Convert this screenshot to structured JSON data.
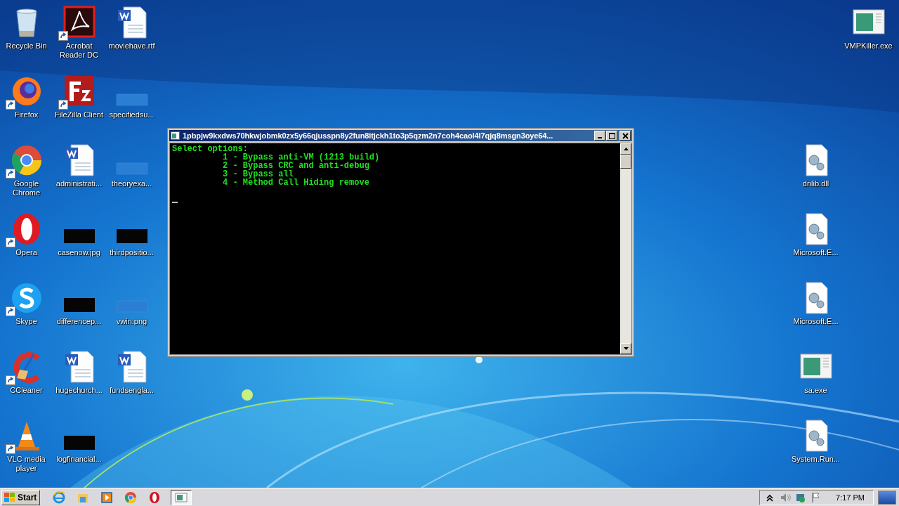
{
  "desktop": {
    "left_columns": [
      [
        {
          "kind": "recycle",
          "label": "Recycle Bin",
          "shortcut": false
        },
        {
          "kind": "firefox",
          "label": "Firefox",
          "shortcut": true
        },
        {
          "kind": "chrome",
          "label": "Google Chrome",
          "shortcut": true
        },
        {
          "kind": "opera",
          "label": "Opera",
          "shortcut": true
        },
        {
          "kind": "skype",
          "label": "Skype",
          "shortcut": true
        },
        {
          "kind": "ccleaner",
          "label": "CCleaner",
          "shortcut": true
        },
        {
          "kind": "vlc",
          "label": "VLC media player",
          "shortcut": true
        }
      ],
      [
        {
          "kind": "acrobat",
          "label": "Acrobat Reader DC",
          "shortcut": true
        },
        {
          "kind": "filezilla",
          "label": "FileZilla Client",
          "shortcut": true
        },
        {
          "kind": "word",
          "label": "administrati...",
          "shortcut": false
        },
        {
          "kind": "dark-thumb",
          "label": "casenow.jpg",
          "shortcut": false
        },
        {
          "kind": "dark-thumb",
          "label": "differencep...",
          "shortcut": false
        },
        {
          "kind": "word",
          "label": "hugechurch...",
          "shortcut": false
        },
        {
          "kind": "dark-thumb",
          "label": "logfinancial...",
          "shortcut": false
        }
      ],
      [
        {
          "kind": "word",
          "label": "moviehave.rtf",
          "shortcut": false
        },
        {
          "kind": "light-thumb",
          "label": "specifiedsu...",
          "shortcut": false
        },
        {
          "kind": "light-thumb",
          "label": "theoryexa...",
          "shortcut": false
        },
        {
          "kind": "dark-thumb",
          "label": "thirdpositio...",
          "shortcut": false
        },
        {
          "kind": "light-thumb",
          "label": "vwin.png",
          "shortcut": false
        },
        {
          "kind": "word",
          "label": "fundsengla...",
          "shortcut": false
        }
      ]
    ],
    "right_columns": [
      [
        {
          "kind": "dll",
          "label": "dnlib.dll",
          "shortcut": false
        },
        {
          "kind": "dll",
          "label": "Microsoft.E...",
          "shortcut": false
        },
        {
          "kind": "dll",
          "label": "Microsoft.E...",
          "shortcut": false
        },
        {
          "kind": "exe",
          "label": "sa.exe",
          "shortcut": false
        },
        {
          "kind": "dll",
          "label": "System.Run...",
          "shortcut": false
        }
      ],
      [
        {
          "kind": "exe",
          "label": "VMPKiller.exe",
          "shortcut": false
        }
      ]
    ]
  },
  "console_window": {
    "title": "1pbpjw9kxdws70hkwjobmk0zx5y66qjusspn8y2fun8itjckh1to3p5qzm2n7coh4caol4l7qjq8msgn3oye64...",
    "lines": [
      {
        "kind": "heading",
        "text": "Select options:"
      },
      {
        "kind": "option",
        "text": "1 - Bypass anti-VM (1213 build)"
      },
      {
        "kind": "option",
        "text": "2 - Bypass CRC and anti-debug"
      },
      {
        "kind": "option",
        "text": "3 - Bypass all"
      },
      {
        "kind": "option",
        "text": "4 - Method Call Hiding remove"
      }
    ]
  },
  "taskbar": {
    "start_label": "Start",
    "pinned": [
      {
        "kind": "ie"
      },
      {
        "kind": "explorer"
      },
      {
        "kind": "media"
      },
      {
        "kind": "chrome"
      },
      {
        "kind": "opera"
      },
      {
        "kind": "console",
        "selected": true
      }
    ],
    "tray": [
      {
        "kind": "chevron"
      },
      {
        "kind": "speaker"
      },
      {
        "kind": "network"
      },
      {
        "kind": "flag"
      }
    ],
    "time": "7:17 PM"
  }
}
